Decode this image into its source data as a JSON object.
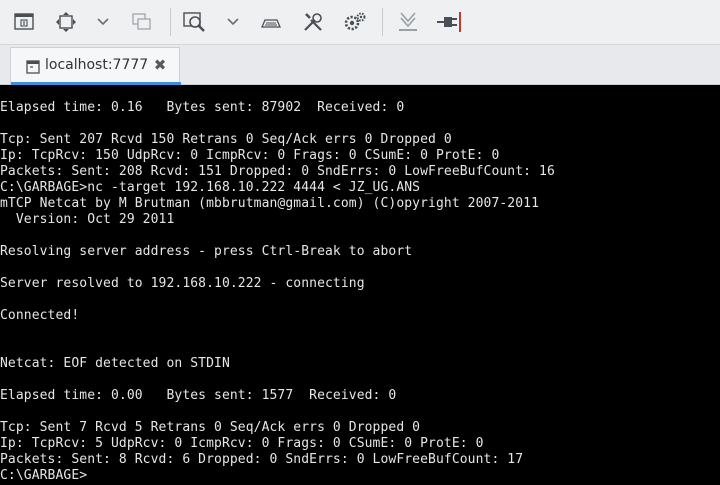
{
  "toolbar": {
    "buttons": [
      {
        "name": "display-icon"
      },
      {
        "name": "move-icon"
      },
      {
        "name": "chevron-down-icon"
      },
      {
        "name": "windows-icon"
      },
      {
        "name": "zoom-icon"
      },
      {
        "name": "chevron-down-icon"
      },
      {
        "name": "keyboard-icon"
      },
      {
        "name": "tools-icon"
      },
      {
        "name": "settings-icon"
      },
      {
        "name": "download-icon"
      },
      {
        "name": "disconnect-icon"
      }
    ]
  },
  "tab": {
    "label": "localhost:7777",
    "close": "✖"
  },
  "terminal": {
    "lines": [
      "Elapsed time: 0.16   Bytes sent: 87902  Received: 0",
      "",
      "Tcp: Sent 207 Rcvd 150 Retrans 0 Seq/Ack errs 0 Dropped 0",
      "Ip: TcpRcv: 150 UdpRcv: 0 IcmpRcv: 0 Frags: 0 CSumE: 0 ProtE: 0",
      "Packets: Sent: 208 Rcvd: 151 Dropped: 0 SndErrs: 0 LowFreeBufCount: 16",
      "C:\\GARBAGE>nc -target 192.168.10.222 4444 < JZ_UG.ANS",
      "mTCP Netcat by M Brutman (mbbrutman@gmail.com) (C)opyright 2007-2011",
      "  Version: Oct 29 2011",
      "",
      "Resolving server address - press Ctrl-Break to abort",
      "",
      "Server resolved to 192.168.10.222 - connecting",
      "",
      "Connected!",
      "",
      "",
      "Netcat: EOF detected on STDIN",
      "",
      "Elapsed time: 0.00   Bytes sent: 1577  Received: 0",
      "",
      "Tcp: Sent 7 Rcvd 5 Retrans 0 Seq/Ack errs 0 Dropped 0",
      "Ip: TcpRcv: 5 UdpRcv: 0 IcmpRcv: 0 Frags: 0 CSumE: 0 ProtE: 0",
      "Packets: Sent: 8 Rcvd: 6 Dropped: 0 SndErrs: 0 LowFreeBufCount: 17",
      "C:\\GARBAGE>"
    ]
  },
  "colors": {
    "accent": "#3d8fe0",
    "terminal_bg": "#000000",
    "terminal_fg": "#e6e6e6",
    "toolbar_bg": "#eef0f2"
  }
}
